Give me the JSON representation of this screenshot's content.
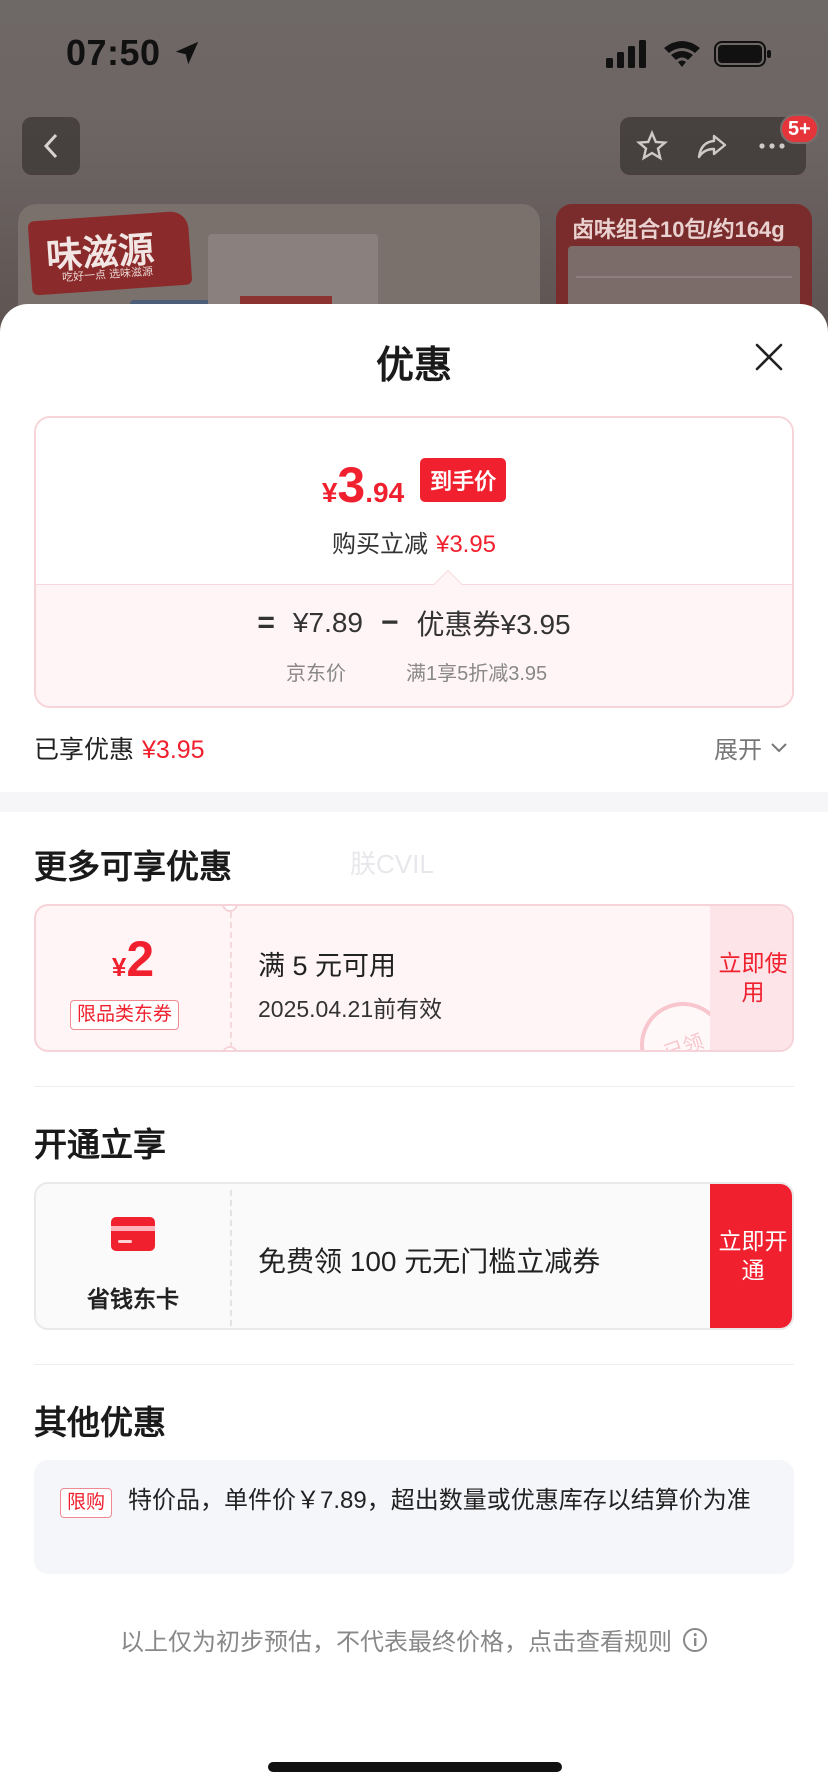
{
  "status_bar": {
    "time": "07:50"
  },
  "header": {
    "badge": "5+"
  },
  "background": {
    "brand_logo": "味滋源",
    "brand_tagline": "吃好一点 选味滋源",
    "product2_title": "卤味组合10包/约164g"
  },
  "sheet": {
    "title": "优惠",
    "price": {
      "currency": "¥",
      "integer": "3",
      "decimal": ".94",
      "tag": "到手价",
      "instant_label": "购买立减",
      "instant_value": "¥3.95"
    },
    "formula": {
      "equals": "=",
      "base_price": "¥7.89",
      "minus": "−",
      "coupon_value": "优惠券¥3.95",
      "base_label": "京东价",
      "coupon_label": "满1享5折减3.95"
    },
    "enjoyed": {
      "label": "已享优惠",
      "value": "¥3.95",
      "expand": "展开"
    },
    "more_section": {
      "title": "更多可享优惠",
      "watermark": "朕CVIL",
      "coupon": {
        "currency": "¥",
        "amount": "2",
        "type": "限品类东券",
        "condition": "满 5 元可用",
        "expiry": "2025.04.21前有效",
        "action": "立即使用",
        "stamp": "已领"
      }
    },
    "member_section": {
      "title": "开通立享",
      "card_name": "省钱东卡",
      "description": "免费领 100 元无门槛立减券",
      "action": "立即开通"
    },
    "other_section": {
      "title": "其他优惠",
      "badge": "限购",
      "text": "特价品，单件价￥7.89，超出数量或优惠库存以结算价为准"
    },
    "footer_note": "以上仅为初步预估，不代表最终价格，点击查看规则"
  },
  "colors": {
    "accent": "#f0202e",
    "coupon_bg": "#fff5f7",
    "card_bg": "#fafafb"
  }
}
